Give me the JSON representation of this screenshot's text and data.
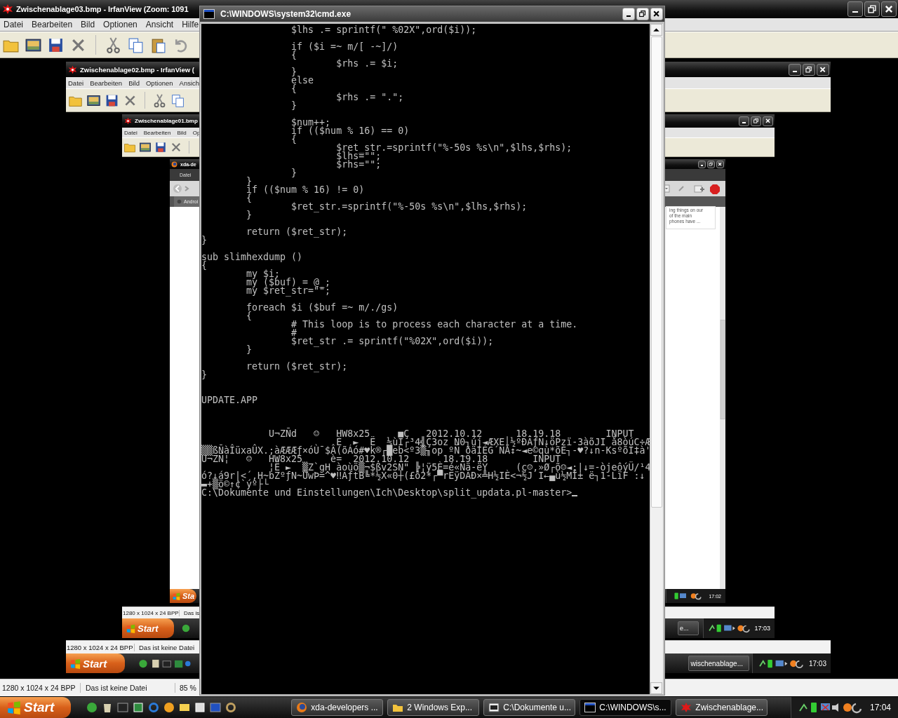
{
  "viewer": {
    "title": "Zwischenablage03.bmp - IrfanView (Zoom: 1091",
    "menu": [
      "Datei",
      "Bearbeiten",
      "Bild",
      "Optionen",
      "Ansicht",
      "Hilfe"
    ],
    "status": [
      "1280 x 1024 x 24 BPP",
      "Das ist keine Datei",
      "85 %"
    ]
  },
  "screenshot_1": {
    "title": "Zwischenablage02.bmp - IrfanView (",
    "menu": [
      "Datei",
      "Bearbeiten",
      "Bild",
      "Optionen",
      "Ansich"
    ],
    "status": [
      "1280 x 1024 x 24 BPP",
      "Das ist keine Datei"
    ],
    "start": "Start",
    "task": "wischenablage...",
    "clock": "17:03"
  },
  "screenshot_2": {
    "title": "Zwischenablage01.bmp",
    "menu": [
      "Datei",
      "Bearbeiten",
      "Bild",
      "Op"
    ],
    "status": [
      "1280 x 1024 x 24 BPP",
      "Das is"
    ],
    "start": "Start",
    "task": "e...",
    "clock": "17:03"
  },
  "screenshot_3": {
    "title": "xda-de",
    "menu": [
      "Datei"
    ],
    "tab": "Androi",
    "snippet": [
      "ing things on our",
      "of the main",
      "phones have ..."
    ],
    "start": "Sta",
    "clock": "17:02"
  },
  "console": {
    "title": "C:\\WINDOWS\\system32\\cmd.exe",
    "lines": [
      {
        "kind": "text",
        "text": "                $lhs .= sprintf(\" %02X\",ord($i));"
      },
      {
        "kind": "blank"
      },
      {
        "kind": "text",
        "text": "                if ($i =~ m/[ -~]/)"
      },
      {
        "kind": "text",
        "text": "                {"
      },
      {
        "kind": "text",
        "text": "                        $rhs .= $i;"
      },
      {
        "kind": "text",
        "text": "                }"
      },
      {
        "kind": "text",
        "text": "                else"
      },
      {
        "kind": "text",
        "text": "                {"
      },
      {
        "kind": "text",
        "text": "                        $rhs .= \".\";"
      },
      {
        "kind": "text",
        "text": "                }"
      },
      {
        "kind": "blank"
      },
      {
        "kind": "text",
        "text": "                $num++;"
      },
      {
        "kind": "text",
        "text": "                if (($num % 16) == 0)"
      },
      {
        "kind": "text",
        "text": "                {"
      },
      {
        "kind": "text",
        "text": "                        $ret_str.=sprintf(\"%-50s %s\\n\",$lhs,$rhs);"
      },
      {
        "kind": "text",
        "text": "                        $lhs=\"\";"
      },
      {
        "kind": "text",
        "text": "                        $rhs=\"\";"
      },
      {
        "kind": "text",
        "text": "                }"
      },
      {
        "kind": "text",
        "text": "        }"
      },
      {
        "kind": "text",
        "text": "        if (($num % 16) != 0)"
      },
      {
        "kind": "text",
        "text": "        {"
      },
      {
        "kind": "text",
        "text": "                $ret_str.=sprintf(\"%-50s %s\\n\",$lhs,$rhs);"
      },
      {
        "kind": "text",
        "text": "        }"
      },
      {
        "kind": "blank"
      },
      {
        "kind": "text",
        "text": "        return ($ret_str);"
      },
      {
        "kind": "text",
        "text": "}"
      },
      {
        "kind": "blank"
      },
      {
        "kind": "text",
        "text": "sub slimhexdump ()"
      },
      {
        "kind": "text",
        "text": "{"
      },
      {
        "kind": "text",
        "text": "        my $i;"
      },
      {
        "kind": "text",
        "text": "        my ($buf) = @_;"
      },
      {
        "kind": "text",
        "text": "        my $ret_str=\"\";"
      },
      {
        "kind": "blank"
      },
      {
        "kind": "text",
        "text": "        foreach $i ($buf =~ m/./gs)"
      },
      {
        "kind": "text",
        "text": "        {"
      },
      {
        "kind": "text",
        "text": "                # This loop is to process each character at a time."
      },
      {
        "kind": "text",
        "text": "                #"
      },
      {
        "kind": "text",
        "text": "                $ret_str .= sprintf(\"%02X\",ord($i));"
      },
      {
        "kind": "text",
        "text": "        }"
      },
      {
        "kind": "blank"
      },
      {
        "kind": "text",
        "text": "        return ($ret_str);"
      },
      {
        "kind": "text",
        "text": "}"
      },
      {
        "kind": "blank"
      },
      {
        "kind": "blank"
      },
      {
        "kind": "text",
        "text": "UPDATE.APP"
      },
      {
        "kind": "blank"
      },
      {
        "kind": "blank"
      },
      {
        "kind": "blank"
      },
      {
        "kind": "text",
        "text": "            U¬ZÑd   ☺   HW8x25     ■Ç   2012.10.12      18.19.18        INPUT"
      },
      {
        "kind": "text",
        "text": "                        È  ►  Ë  ½ùI┌³4╣Ç3oz Ñ0┐új◄ÆXE│½ºÐÄƒN↓öPzï-3àõJI å8òúC÷Æ"
      },
      {
        "kind": "text",
        "text": "▒▒ßÑàÎüxaÛX.;àÆÆÆƒ×óÙ¯$Â(õÁó#♥k®┌█eb<º3▒╖op ºÑ_ðäIÉG´ÑÄ↕~◄e©qù*õÈ┐-♥?↓n-KsºõÌ‡à'"
      },
      {
        "kind": "text",
        "text": "U¬ZÑ¦   ☺   HW8x25     è=  2012.10.12      18.19.18        INPUT"
      },
      {
        "kind": "text",
        "text": "            ¦Ê ►  ▒Z`gH àoùö▒¬$ßv2SÑ\" ╠¦ÿ5È=é«Ñä-ëY     (ç☺,»Ø┌õ☺◄;|↓=-òjeôýÜ/¹4"
      },
      {
        "kind": "text",
        "text": "ó?↓á9r|<´,H~bZºƒN~ÜwÞ=^♥‼AƒtB╚*½X«0┼(£ô2*┌▀rEÿDÁÐ×╩H½IÈ<¬½J I←▄ù½MÏ± ë┐1-LïF :↓"
      },
      {
        "kind": "text",
        "text": "▬+▒ö©↑¢`ýº├└"
      },
      {
        "kind": "prompt",
        "text": "C:\\Dokumente und Einstellungen\\Ich\\Desktop\\split_updata.pl-master>"
      }
    ]
  },
  "taskbar": {
    "start": "Start",
    "tasks": [
      {
        "label": "xda-developers ...",
        "kind": "browser",
        "selected": false
      },
      {
        "label": "2 Windows Exp...",
        "kind": "folder",
        "selected": false
      },
      {
        "label": "C:\\Dokumente u...",
        "kind": "archive",
        "selected": false
      },
      {
        "label": "C:\\WINDOWS\\s...",
        "kind": "console",
        "selected": true
      },
      {
        "label": "Zwischenablage...",
        "kind": "viewer",
        "selected": false
      }
    ],
    "clock": "17:04"
  }
}
